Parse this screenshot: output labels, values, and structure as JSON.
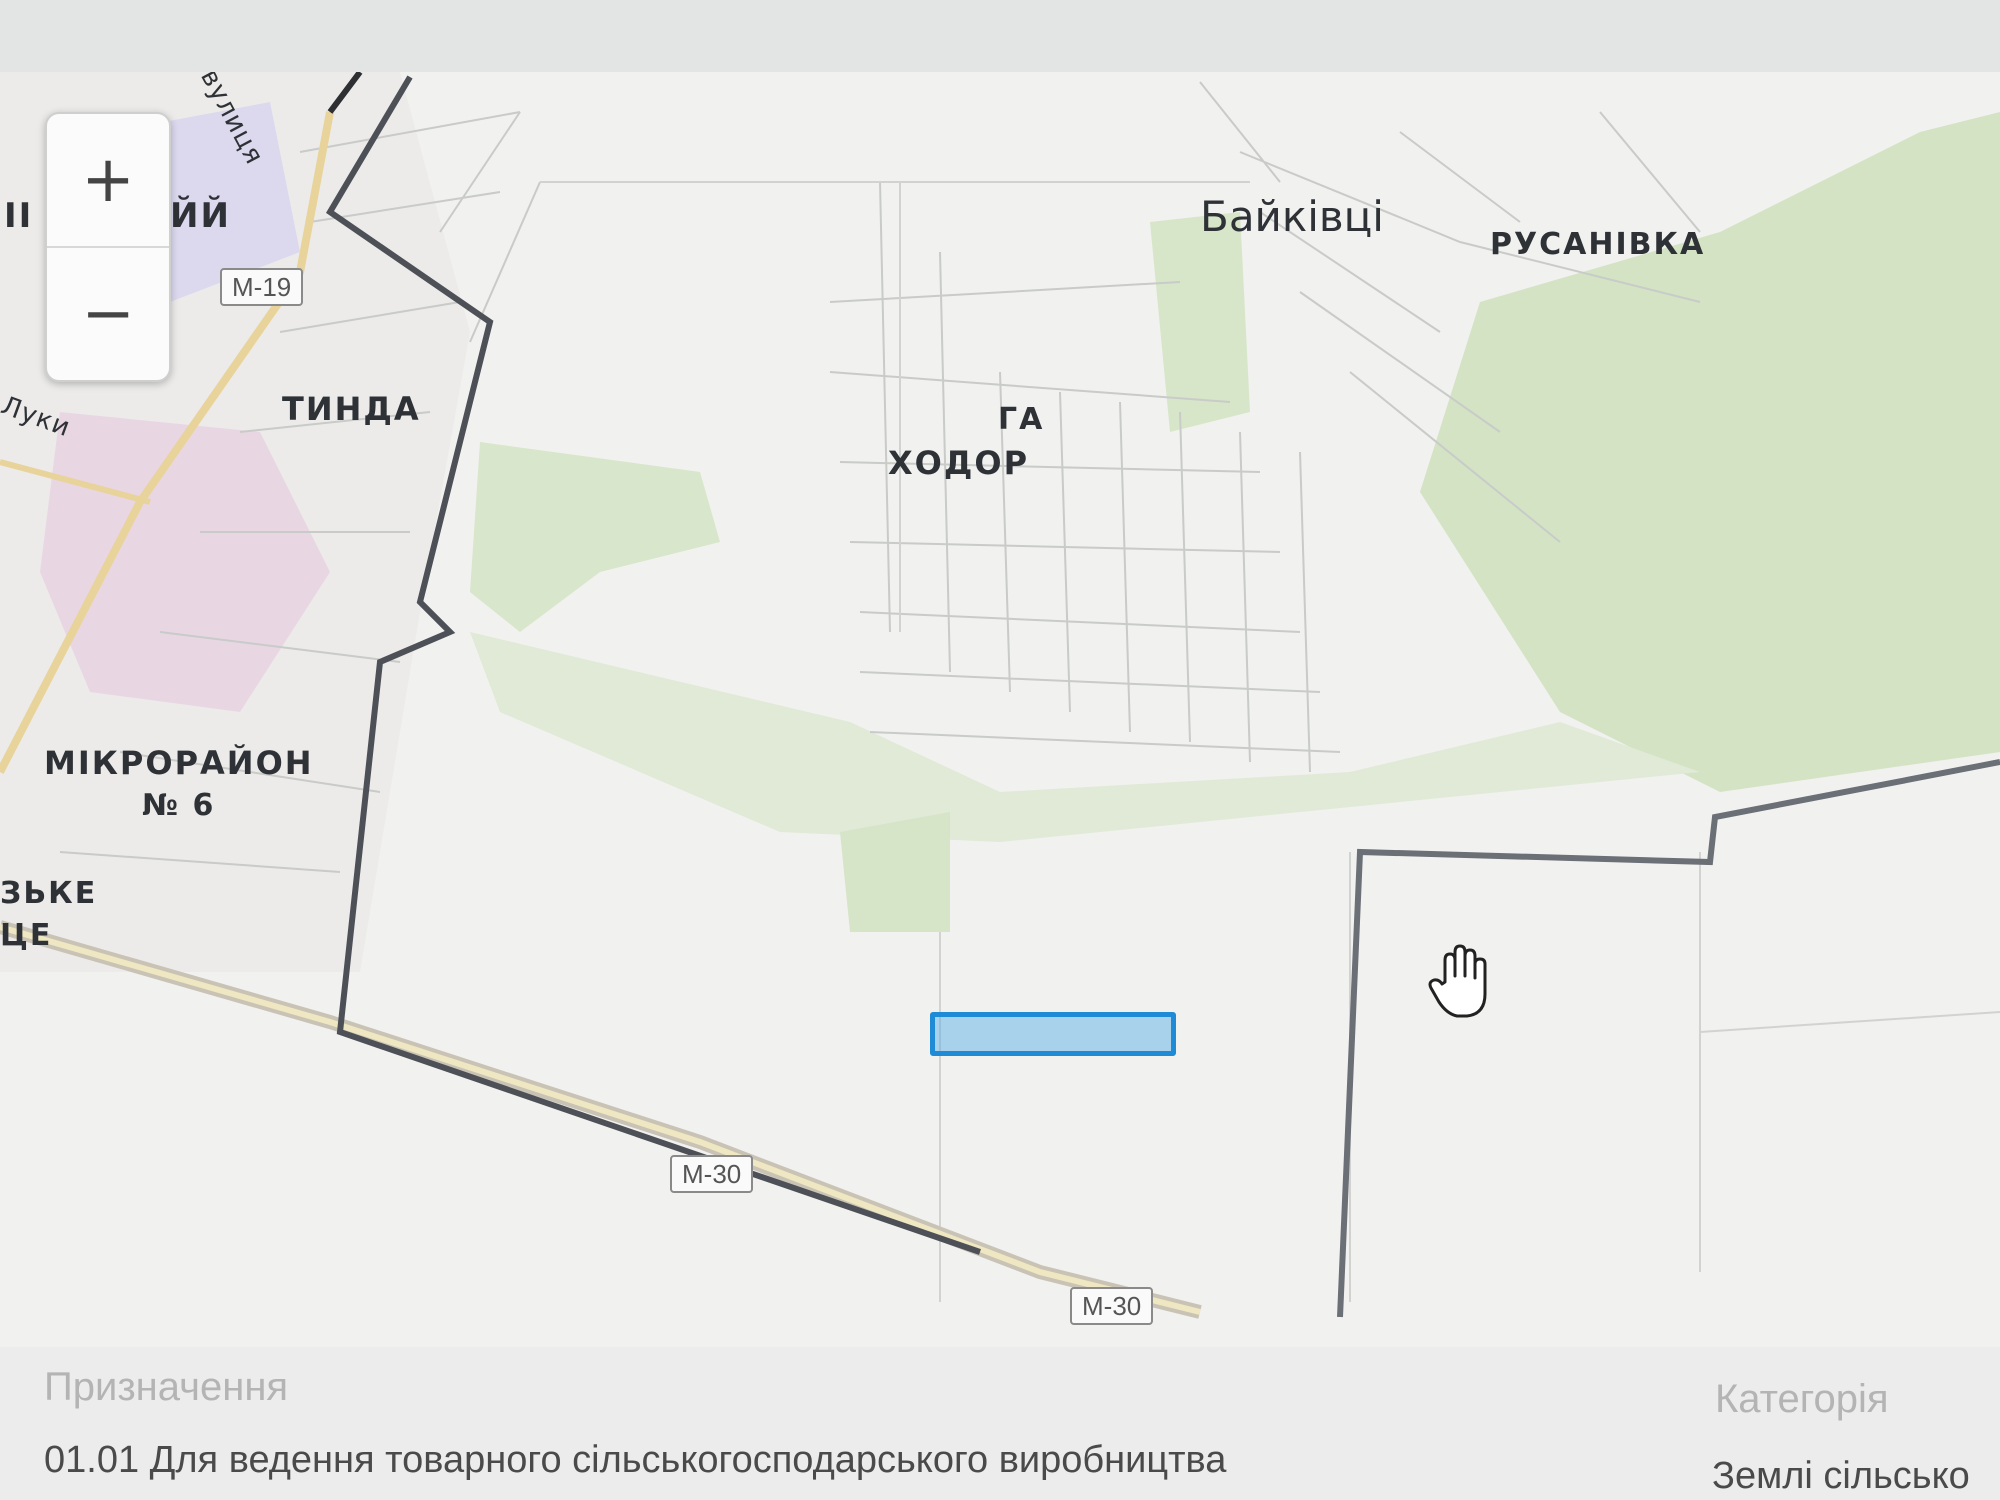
{
  "map": {
    "zoom_in_label": "+",
    "zoom_out_label": "−",
    "labels": {
      "bayikivtsi": "Байківці",
      "rusanivka": "РУСАНІВКА",
      "tynda": "ТИНДА",
      "khodory_partial": "ХОДОР",
      "ga_partial": "ГА",
      "mikroraion": "МІКРОРАЙОН",
      "mikroraion_num": "№ 6",
      "zke_partial": "ЗЬКЕ",
      "tse_partial": "ЦЕ",
      "yi_partial": "ЙЙ",
      "ii_partial": "ІІ",
      "street_partial": "вулиця",
      "luky_partial": "Луки"
    },
    "roads": {
      "m19": "M-19",
      "m30_a": "M-30",
      "m30_b": "M-30"
    },
    "colors": {
      "parcel_highlight": "#1f8ad6",
      "greenery": "#cfe0c0",
      "boundary": "#6b6f76"
    }
  },
  "info": {
    "purpose_label": "Призначення",
    "purpose_value": "01.01 Для ведення товарного сільськогосподарського виробництва",
    "category_label": "Категорія",
    "category_value": "Землі сільсько"
  }
}
